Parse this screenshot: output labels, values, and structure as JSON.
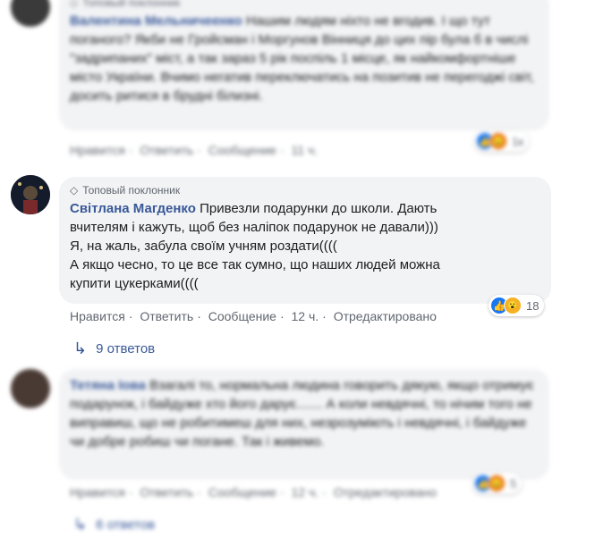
{
  "comments": [
    {
      "badge": "Топовый поклонник",
      "author": "Валентина Мельничеенко",
      "text": "Нашим людям ніхто не вгодив. І що тут поганого? Якби не Гройсман і Моргунов Вінниця до цих пір була б в числі \"задрипаних\" міст, а так зараз 5 рік поспіль 1 місце, як найкомфортніше місто України. Вчимо негатив переключатись на позитив не перегоджі світ, досить ритися в брудні білизні.",
      "actions": [
        "Нравится",
        "Ответить",
        "Сообщение",
        "11 ч."
      ],
      "reaction_count": "1к"
    },
    {
      "badge": "Топовый поклонник",
      "author": "Світлана Магденко",
      "text_lines": [
        "Привезли подарунки до школи. Дають",
        "вчителям і кажуть, щоб без наліпок подарунок не давали)))",
        "Я, на жаль, забула своїм учням роздати((((",
        "А якщо чесно, то це все так сумно, що наших людей можна",
        "купити цукерками(((("
      ],
      "actions": [
        "Нравится",
        "Ответить",
        "Сообщение",
        "12 ч.",
        "Отредактировано"
      ],
      "reaction_count": "18",
      "replies_label": "9 ответов"
    },
    {
      "author": "Тетяна Іова",
      "text": "Взагалі то, нормальна людина говорить дякую, якщо отримує подарунок, і байдуже хто його дарує....... А коли невдячні, то нічим того не виправиш, що не робитимеш для них, незрозуміють і невдячні, і байдуже чи добре робиш чи погане. Так і живемо.",
      "actions": [
        "Нравится",
        "Ответить",
        "Сообщение",
        "12 ч.",
        "Отредактировано"
      ],
      "reaction_count": "5",
      "replies_label": "6 ответов"
    }
  ]
}
